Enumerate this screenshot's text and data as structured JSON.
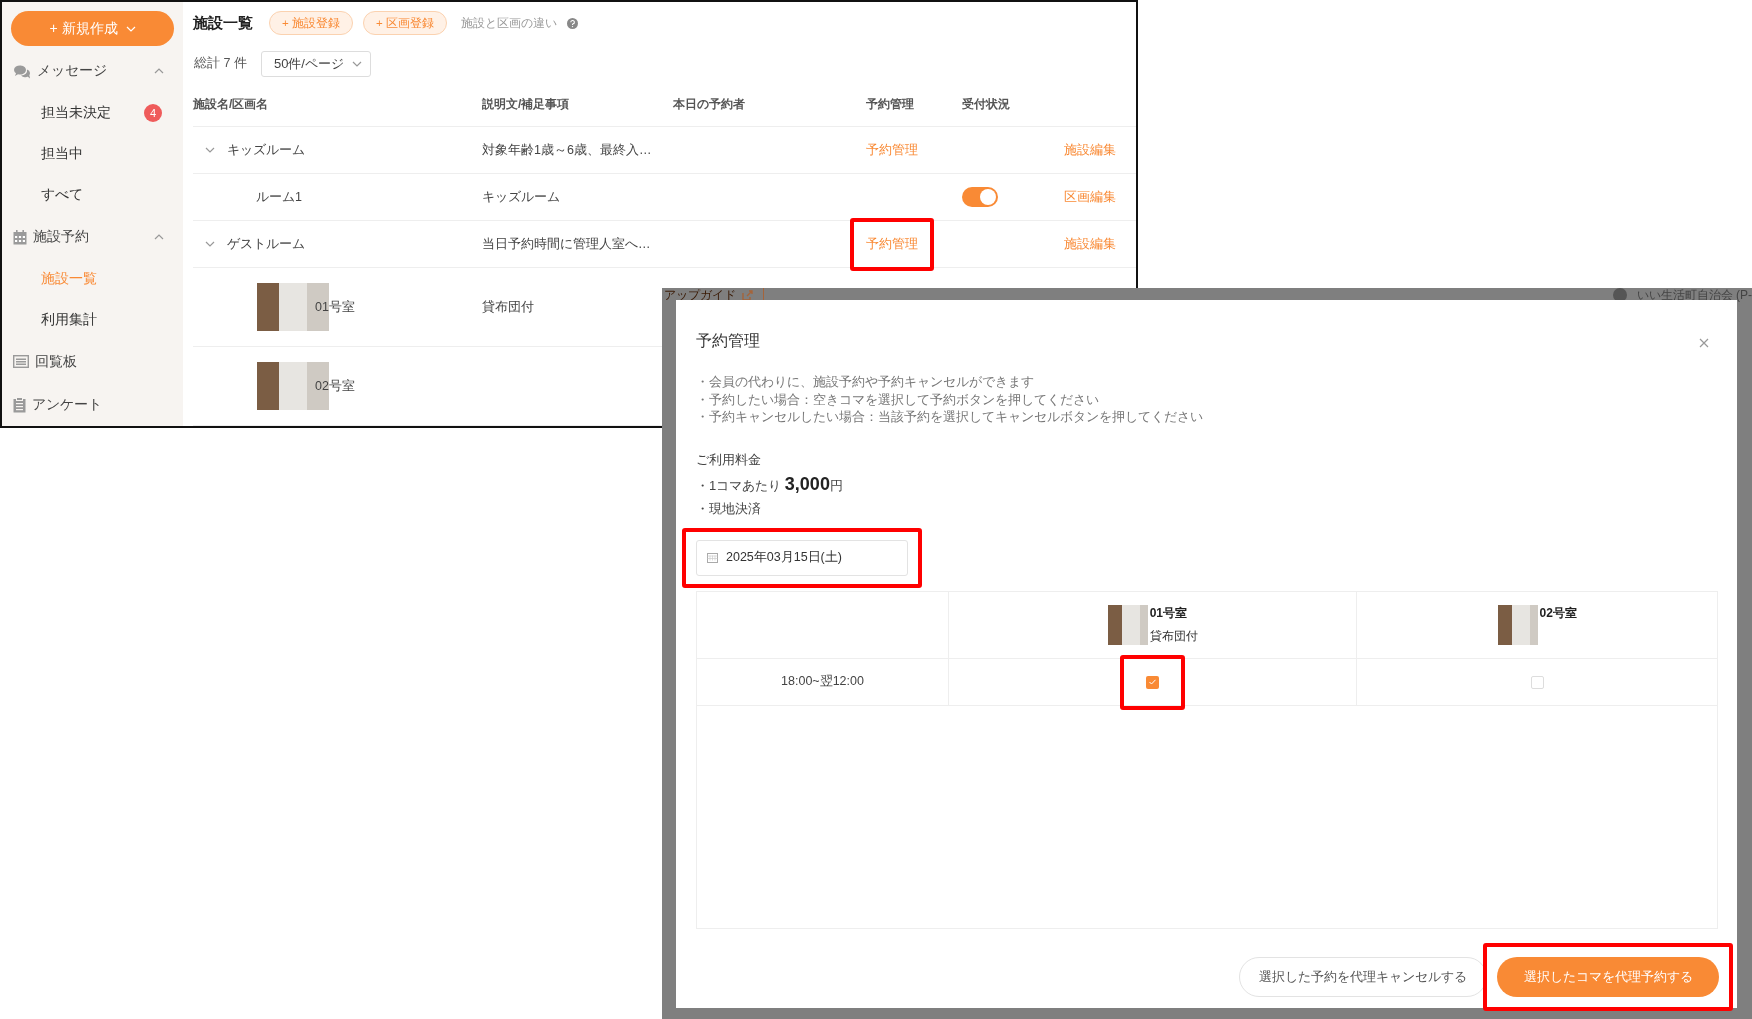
{
  "admin": {
    "new_button": "+ 新規作成",
    "sidebar": [
      {
        "label": "メッセージ",
        "expanded": true,
        "children": [
          {
            "label": "担当未決定",
            "selected": false,
            "badge": "4"
          },
          {
            "label": "担当中",
            "selected": false
          },
          {
            "label": "すべて",
            "selected": false
          }
        ]
      },
      {
        "label": "施設予約",
        "expanded": true,
        "children": [
          {
            "label": "施設一覧",
            "selected": true
          },
          {
            "label": "利用集計",
            "selected": false
          }
        ]
      },
      {
        "label": "回覧板"
      },
      {
        "label": "アンケート"
      }
    ],
    "title": "施設一覧",
    "actions": [
      "+ 施設登録",
      "+ 区画登録"
    ],
    "help": "施設と区画の違い",
    "total": "総計 7 件",
    "page_size": "50件/ページ",
    "columns": [
      "施設名/区画名",
      "説明文/補足事項",
      "本日の予約者",
      "予約管理",
      "受付状況"
    ],
    "rows": [
      {
        "kind": "facility",
        "name": "キッズルーム",
        "description": "対象年齢1歳～6歳、最終入…",
        "manage": "予約管理",
        "highlighted": false,
        "edit": "施設編集"
      },
      {
        "kind": "section",
        "name": "ルーム1",
        "description": "キッズルーム",
        "accepting": true,
        "edit": "区画編集"
      },
      {
        "kind": "facility",
        "name": "ゲストルーム",
        "description": "当日予約時間に管理人室へ…",
        "manage": "予約管理",
        "highlighted": true,
        "edit": "施設編集"
      },
      {
        "kind": "photo",
        "name": "01号室",
        "description": "貸布団付"
      },
      {
        "kind": "photo",
        "name": "02号室"
      }
    ]
  },
  "behind": {
    "guide": "アップガイド",
    "account": "いい生活町自治会 (P-"
  },
  "modal": {
    "title": "予約管理",
    "notes": [
      "・会員の代わりに、施設予約や予約キャンセルができます",
      "・予約したい場合：空きコマを選択して予約ボタンを押してください",
      "・予約キャンセルしたい場合：当該予約を選択してキャンセルボタンを押してください"
    ],
    "fee_heading": "ご利用料金",
    "fee_line": "・1コマあたり **3,000**円",
    "payment": "・現地決済",
    "date": {
      "value": "2025年03月15日(土)",
      "highlighted": true
    },
    "rooms": [
      {
        "name": "01号室",
        "note": "貸布団付"
      },
      {
        "name": "02号室"
      }
    ],
    "slots": [
      {
        "time": "18:00~翌12:00",
        "cells": [
          {
            "checked": true,
            "highlighted": true
          },
          {
            "checked": false,
            "highlighted": false
          }
        ]
      }
    ],
    "cancel_button": "選択した予約を代理キャンセルする",
    "submit_button": {
      "label": "選択したコマを代理予約する",
      "highlighted": true
    }
  }
}
